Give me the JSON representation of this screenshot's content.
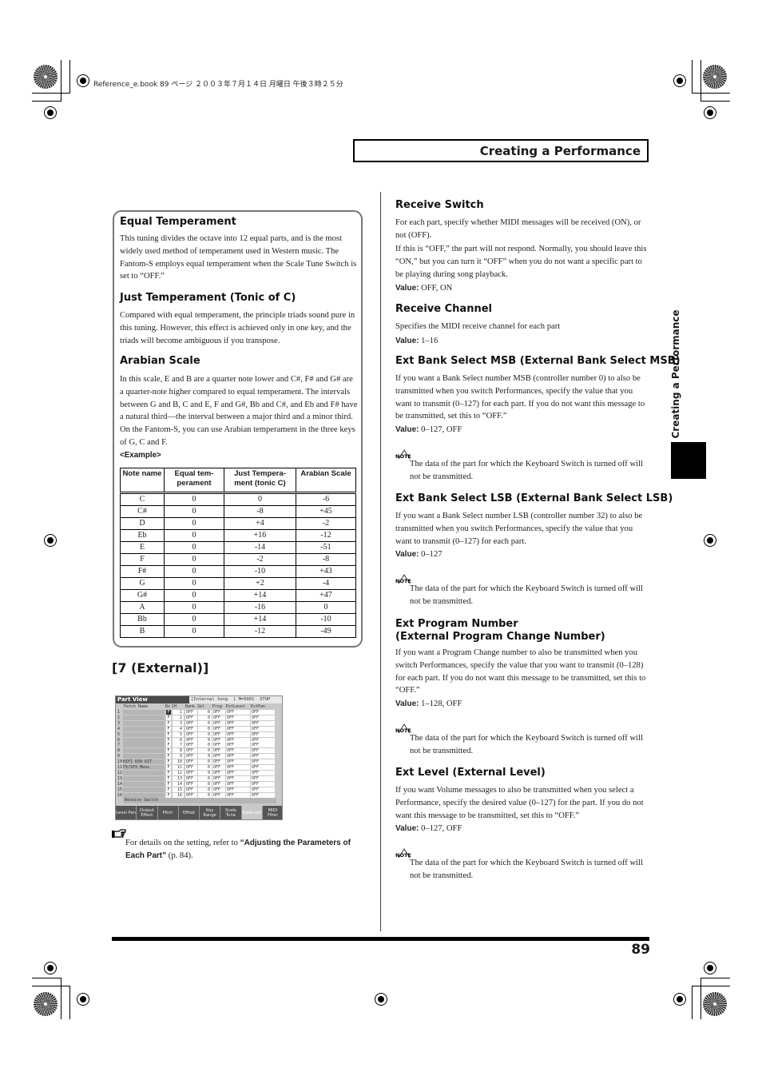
{
  "print_header": "Reference_e.book  89 ページ  ２００３年７月１４日  月曜日  午後３時２５分",
  "chapter_title": "Creating a Performance",
  "side_tab": "Creating a Performance",
  "left": {
    "box": {
      "equal": {
        "title": "Equal Temperament",
        "body": "This tuning divides the octave into 12 equal parts, and is the most widely used method of temperament used in Western music. The Fantom-S employs equal temperament when the Scale Tune Switch is set to “OFF.”"
      },
      "just": {
        "title": "Just Temperament (Tonic of C)",
        "body": "Compared with equal temperament, the principle triads sound pure in this tuning. However, this effect is achieved only in one key, and the triads will become ambiguous if you transpose."
      },
      "arabian": {
        "title": "Arabian Scale",
        "body": "In this scale, E and B are a quarter note lower and C#, F# and G# are a quarter-note higher compared to equal temperament. The intervals between G and B, C and E, F and G#, Bb and C#, and Eb and F# have a natural third—the interval between a major third and a minor third. On the Fantom-S, you can use Arabian temperament in the three keys of G, C and F."
      },
      "example_label": "<Example>",
      "table": {
        "headers": [
          "Note name",
          "Equal tem-perament",
          "Just Tempera-ment (tonic C)",
          "Arabian Scale"
        ],
        "rows": [
          [
            "C",
            "0",
            "0",
            "-6"
          ],
          [
            "C#",
            "0",
            "-8",
            "+45"
          ],
          [
            "D",
            "0",
            "+4",
            "-2"
          ],
          [
            "Eb",
            "0",
            "+16",
            "-12"
          ],
          [
            "E",
            "0",
            "-14",
            "-51"
          ],
          [
            "F",
            "0",
            "-2",
            "-8"
          ],
          [
            "F#",
            "0",
            "-10",
            "+43"
          ],
          [
            "G",
            "0",
            "+2",
            "-4"
          ],
          [
            "G#",
            "0",
            "+14",
            "+47"
          ],
          [
            "A",
            "0",
            "-16",
            "0"
          ],
          [
            "Bb",
            "0",
            "+14",
            "-10"
          ],
          [
            "B",
            "0",
            "-12",
            "-49"
          ]
        ]
      }
    },
    "section_title": "[7 (External)]",
    "lcd": {
      "title": "Part View",
      "status": "[Internal Song  ] M=0001  STOP",
      "col_headers": [
        "Patch Name",
        "Rx",
        "CH",
        "Bank",
        "Sel",
        "Prog",
        "ExtLevel",
        "ExtPan"
      ],
      "parts": [
        {
          "n": "1",
          "name": "",
          "ch": "1"
        },
        {
          "n": "2",
          "name": "",
          "ch": "2"
        },
        {
          "n": "3",
          "name": "",
          "ch": "3"
        },
        {
          "n": "4",
          "name": "",
          "ch": "4"
        },
        {
          "n": "5",
          "name": "",
          "ch": "5"
        },
        {
          "n": "6",
          "name": "",
          "ch": "6"
        },
        {
          "n": "7",
          "name": "",
          "ch": "7"
        },
        {
          "n": "8",
          "name": "",
          "ch": "8"
        },
        {
          "n": "9",
          "name": "",
          "ch": "9"
        },
        {
          "n": "10",
          "name": "HIFI RSB KIT",
          "ch": "10"
        },
        {
          "n": "11",
          "name": "FX/SFX Menu",
          "ch": "11"
        },
        {
          "n": "12",
          "name": "",
          "ch": "12"
        },
        {
          "n": "13",
          "name": "",
          "ch": "13"
        },
        {
          "n": "14",
          "name": "",
          "ch": "14"
        },
        {
          "n": "15",
          "name": "",
          "ch": "15"
        },
        {
          "n": "16",
          "name": "",
          "ch": "16"
        }
      ],
      "cell_values": {
        "bank": "OFF",
        "sel": "0",
        "prog": "OFF",
        "ext_level": "OFF",
        "ext_pan": "OFF",
        "rx": "F"
      },
      "footer": "Receive Switch",
      "tabs": [
        {
          "label": "Level Pan",
          "active": false
        },
        {
          "label": "Output Effect",
          "active": false
        },
        {
          "label": "Pitch",
          "active": false
        },
        {
          "label": "Offset",
          "active": false
        },
        {
          "label": "Key Range",
          "active": false
        },
        {
          "label": "Scale Tune",
          "active": false
        },
        {
          "label": "Exter-nal",
          "active": true
        },
        {
          "label": "MIDI Filter",
          "active": false
        }
      ]
    },
    "ref": {
      "prefix": "For details on the setting, refer to ",
      "link": "“Adjusting the Parameters of Each Part”",
      "suffix": " (p. 84)."
    }
  },
  "right": {
    "value_label": "Value:",
    "note_label": "NOTE",
    "sections": [
      {
        "title": "Receive Switch",
        "body": [
          "For each part, specify whether MIDI messages will be received (ON), or not (OFF).",
          "If this is “OFF,” the part will not respond. Normally, you should leave this “ON,” but you can turn it “OFF” when you do not want a specific part to be playing during song playback."
        ],
        "value": "OFF, ON"
      },
      {
        "title": "Receive Channel",
        "body": [
          "Specifies the MIDI receive channel for each part"
        ],
        "value": "1–16"
      },
      {
        "title": "Ext Bank Select MSB (External Bank Select MSB)",
        "body": [
          "If you want a Bank Select number MSB (controller number 0) to also be transmitted when you switch Performances, specify the value that you want to transmit (0–127) for each part. If you do not want this message to be transmitted, set this to “OFF.”"
        ],
        "value": "0–127, OFF",
        "note": "The data of the part for which the Keyboard Switch is turned off will not be transmitted."
      },
      {
        "title": "Ext Bank Select LSB (External Bank Select LSB)",
        "body": [
          "If you want a Bank Select number LSB (controller number 32) to also be transmitted when you switch Performances, specify the value that you want to transmit (0–127) for each part."
        ],
        "value": "0–127",
        "note": "The data of the part for which the Keyboard Switch is turned off will not be transmitted."
      },
      {
        "title": "Ext Program Number\n(External Program Change Number)",
        "body": [
          "If you want a Program Change number to also be transmitted when you switch Performances, specify the value that you want to transmit (0–128) for each part. If you do not want this message to be transmitted, set this to “OFF.”"
        ],
        "value": "1–128, OFF",
        "note": "The data of the part for which the Keyboard Switch is turned off will not be transmitted."
      },
      {
        "title": "Ext Level (External Level)",
        "body": [
          "If you want Volume messages to also be transmitted when you select a Performance, specify the desired value (0–127) for the part. If you do not want this message to be transmitted, set this to “OFF.”"
        ],
        "value": "0–127, OFF",
        "note": "The data of the part for which the Keyboard Switch is turned off will not be transmitted."
      }
    ]
  },
  "page_number": "89"
}
